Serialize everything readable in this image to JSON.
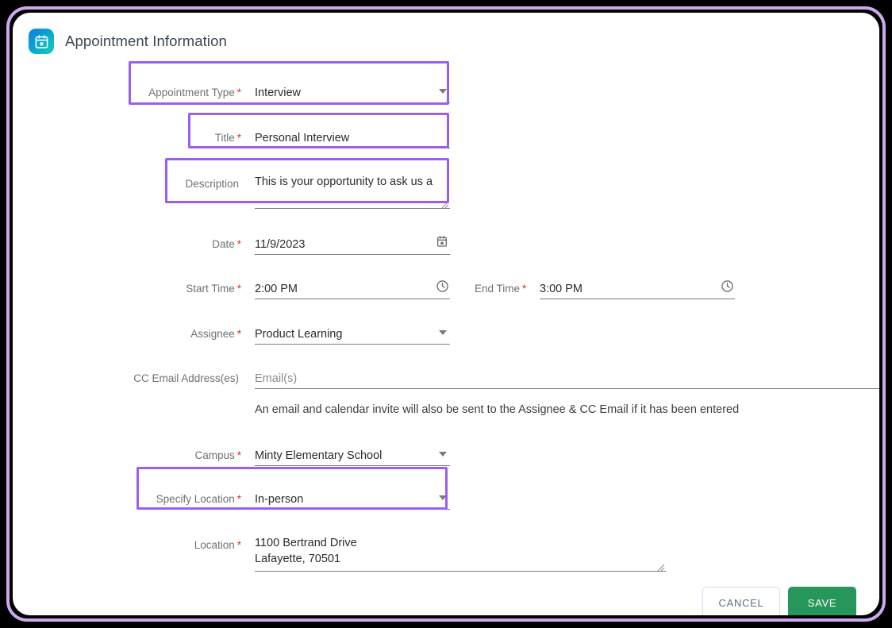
{
  "header": {
    "title": "Appointment Information",
    "icon": "calendar-icon"
  },
  "theme": {
    "highlight": "#9b5ff0",
    "frame_border": "#cda8ef",
    "required_marker": "#f4261c",
    "save_green": "#27965a",
    "cancel_text": "#5c7085",
    "icon_gradient_from": "#0b7fe0",
    "icon_gradient_to": "#11cfb4"
  },
  "form": {
    "appointment_type": {
      "label": "Appointment Type",
      "required": "*",
      "value": "Interview",
      "control": "dropdown",
      "highlighted": true
    },
    "title": {
      "label": "Title",
      "required": "*",
      "value": "Personal Interview",
      "control": "text",
      "highlighted": true
    },
    "description": {
      "label": "Description",
      "required": "",
      "value": "This is your opportunity to ask us a",
      "control": "textarea",
      "highlighted": true
    },
    "date": {
      "label": "Date",
      "required": "*",
      "value": "11/9/2023",
      "control": "date",
      "icon": "calendar-icon"
    },
    "start_time": {
      "label": "Start Time",
      "required": "*",
      "value": "2:00 PM",
      "control": "time",
      "icon": "clock-icon"
    },
    "end_time": {
      "label": "End Time",
      "required": "*",
      "value": "3:00 PM",
      "control": "time",
      "icon": "clock-icon"
    },
    "assignee": {
      "label": "Assignee",
      "required": "*",
      "value": "Product Learning",
      "control": "dropdown"
    },
    "cc_email": {
      "label": "CC Email Address(es)",
      "required": "",
      "value": "",
      "placeholder": "Email(s)",
      "control": "text"
    },
    "helper_text": "An email and calendar invite will also be sent to the Assignee & CC Email if it has been entered",
    "campus": {
      "label": "Campus",
      "required": "*",
      "value": "Minty Elementary School",
      "control": "dropdown"
    },
    "specify_location": {
      "label": "Specify Location",
      "required": "*",
      "value": "In-person",
      "control": "dropdown",
      "highlighted": true
    },
    "location": {
      "label": "Location",
      "required": "*",
      "value": "1100 Bertrand Drive\nLafayette, 70501",
      "control": "textarea"
    }
  },
  "footer": {
    "cancel_label": "CANCEL",
    "save_label": "SAVE"
  }
}
